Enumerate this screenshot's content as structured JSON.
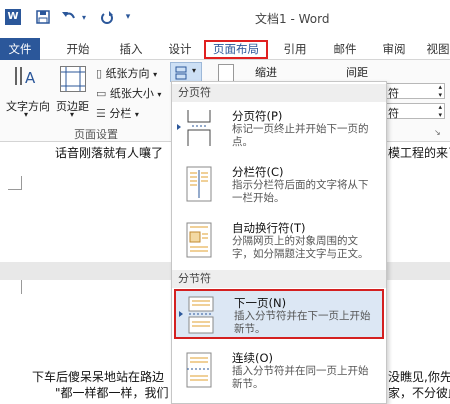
{
  "window": {
    "title": "文档1 - Word"
  },
  "tabs": [
    "文件",
    "开始",
    "插入",
    "设计",
    "页面布局",
    "引用",
    "邮件",
    "审阅",
    "视图"
  ],
  "ribbon": {
    "text_direction": "文字方向",
    "margins": "页边距",
    "orientation": "纸张方向",
    "size": "纸张大小",
    "columns": "分栏",
    "indent": "缩进",
    "spacing": "间距",
    "row1_value": "符",
    "row2_value": "符",
    "group_label": "页面设置"
  },
  "dropdown": {
    "section_page_breaks": "分页符",
    "section_section_breaks": "分节符",
    "items": [
      {
        "title": "分页符(P)",
        "desc": "标记一页终止并开始下一页的\n点。"
      },
      {
        "title": "分栏符(C)",
        "desc": "指示分栏符后面的文字将从下\n一栏开始。"
      },
      {
        "title": "自动换行符(T)",
        "desc": "分隔网页上的对象周围的文\n字，如分隔题注文字与正文。"
      },
      {
        "title": "下一页(N)",
        "desc": "插入分节符并在下一页上开始\n新节。"
      },
      {
        "title": "连续(O)",
        "desc": "插入分节符并在同一页上开始\n新节。"
      }
    ]
  },
  "document": {
    "line1_left": "话音刚落就有人嚷了",
    "line1_right": "模工程的来了",
    "line2_left": "下车后傻呆呆地站在路边",
    "line2_right": "没瞧见,你先",
    "line3_left": "\"都一样都一样，我们",
    "line3_right": "家，不分彼此"
  },
  "colors": {
    "accent": "#2b579a",
    "highlight": "#d42020",
    "selected_bg": "#dce7f4"
  }
}
